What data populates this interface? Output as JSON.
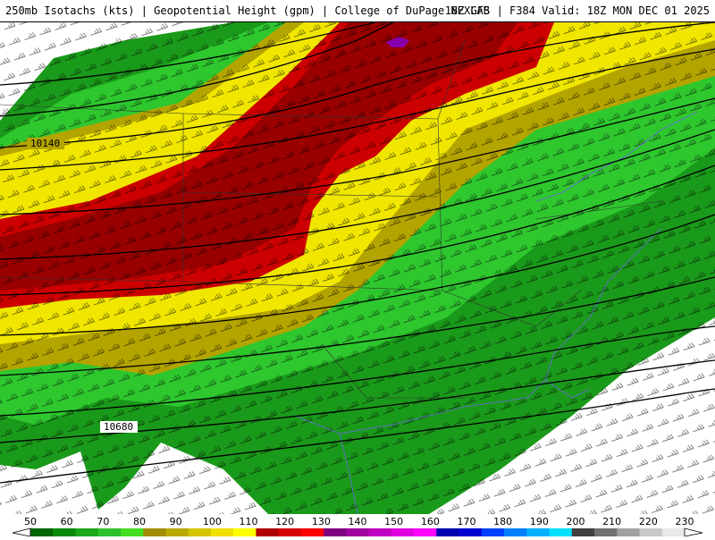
{
  "header": {
    "left": "250mb Isotachs (kts) | Geopotential Height (gpm) | College of DuPage NEXLAB",
    "right": "18Z GFS | F384 Valid: 18Z MON DEC 01 2025"
  },
  "contour_labels": [
    "10140",
    "10680"
  ],
  "colorbar": {
    "labels": [
      "50",
      "60",
      "70",
      "80",
      "90",
      "100",
      "110",
      "120",
      "130",
      "140",
      "150",
      "160",
      "170",
      "180",
      "190",
      "200",
      "210",
      "220",
      "230"
    ],
    "colors": [
      "#006400",
      "#0a8a0a",
      "#1aa81a",
      "#2dc22d",
      "#44dd22",
      "#a08c00",
      "#b8a800",
      "#d4c400",
      "#f0e000",
      "#ffff00",
      "#b00000",
      "#d40000",
      "#ff0000",
      "#800080",
      "#a000a0",
      "#c000c0",
      "#e000e0",
      "#ff00ff",
      "#0000b0",
      "#0000d0",
      "#0040ff",
      "#0080ff",
      "#00b0ff",
      "#00e0ff",
      "#404040",
      "#707070",
      "#a0a0a0",
      "#c8c8c8",
      "#e8e8e8"
    ]
  },
  "colors": {
    "green_dark": "#1a9a1a",
    "green": "#2ec72e",
    "green_light": "#44dd22",
    "olive": "#b4a400",
    "yellow": "#f0e600",
    "red": "#cc0000",
    "dark_red": "#990000",
    "purple": "#8800aa",
    "land": "#ffffff"
  }
}
